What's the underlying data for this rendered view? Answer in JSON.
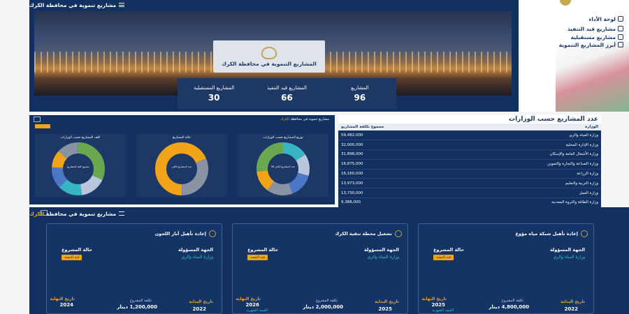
{
  "sidebar": {
    "items": [
      {
        "label": "لوحة الأداء",
        "icon": "dashboard-icon"
      },
      {
        "label": "مشاريع قيد التنفيذ",
        "icon": "progress-icon"
      },
      {
        "label": "مشاريع مستقبلية",
        "icon": "calendar-icon"
      },
      {
        "label": "أبرز المشاريع التنموية",
        "icon": "star-icon"
      }
    ]
  },
  "hero": {
    "header": "مشاريع تنموية في محافظة الكرك",
    "title": "المشاريع التنموية في محافظة الكرك",
    "stats": [
      {
        "label": "المشاريع",
        "value": "96"
      },
      {
        "label": "المشاريع قيد التنفيذ",
        "value": "66"
      },
      {
        "label": "المشاريع المستقبلية",
        "value": "30"
      }
    ]
  },
  "charts_panel": {
    "header_prefix": "مشاريع تنموية في محافظة ",
    "header_highlight": "الكرك",
    "cards": [
      {
        "title": "كلف المشاريع حسب الوزارات",
        "center": "مجموع كلف المشاريع"
      },
      {
        "title": "حالة المشاريع",
        "center": "عدد المشاريع الكلي"
      },
      {
        "title": "توزيع المشاريع حسب الوزارات",
        "center": "عدد المشاريع الكلي 96"
      }
    ],
    "colors": {
      "orange": "#f2a418",
      "grey": "#8a93a3",
      "green": "#6aa84f",
      "teal": "#37b5c4",
      "blue": "#4a78c7",
      "light": "#b9c6dd",
      "dark": "#2e4e8a"
    }
  },
  "ministries": {
    "header": "عدد المشاريع حسب الوزارات",
    "columns": [
      "الوزارة",
      "مجموع تكلفة المشاريع"
    ],
    "rows": [
      {
        "name": "وزارة المياه والري",
        "cost": "59,482,000"
      },
      {
        "name": "وزارة الإدارة المحلية",
        "cost": "32,000,000"
      },
      {
        "name": "وزارة الأشغال العامة والإسكان",
        "cost": "31,898,000"
      },
      {
        "name": "وزارة الصناعة والتجارة والتموين",
        "cost": "16,875,000"
      },
      {
        "name": "وزارة الزراعة",
        "cost": "16,160,000"
      },
      {
        "name": "وزارة التربية والتعليم",
        "cost": "13,973,000"
      },
      {
        "name": "وزارة العمل",
        "cost": "13,730,000"
      },
      {
        "name": "وزارة الطاقة والثروة المعدنية",
        "cost": "9,388,000"
      }
    ]
  },
  "projects": {
    "header_prefix": "مشاريع تنموية في محافظة ",
    "header_highlight": "الكرك",
    "labels": {
      "responsible": "الجهة المسؤولة",
      "status": "حالة المشروع",
      "start": "تاريخ البداية",
      "end": "تاريخ النهاية",
      "cost": "تكلفة المشروع"
    },
    "cards": [
      {
        "title": "إعادة تأهيل شبكة مياه مؤوع",
        "entity": "وزارة المياه والري",
        "status": "قيد التنفيذ",
        "start": "2022",
        "end": "2025",
        "cost": "4,800,000 دينار",
        "end_note": "القيمة الشهرية"
      },
      {
        "title": "تشغيل محطة تنقية الكرك",
        "entity": "وزارة المياه والري",
        "status": "قيد التنفيذ",
        "start": "2025",
        "end": "2026",
        "cost": "2,000,000 دينار",
        "end_note": "القيمة الشهرية"
      },
      {
        "title": "إعادة تأهيل آبار اللجون",
        "entity": "وزارة المياه والري",
        "status": "قيد التنفيذ",
        "start": "2022",
        "end": "2024",
        "cost": "1,200,000 دينار",
        "end_note": ""
      }
    ]
  }
}
